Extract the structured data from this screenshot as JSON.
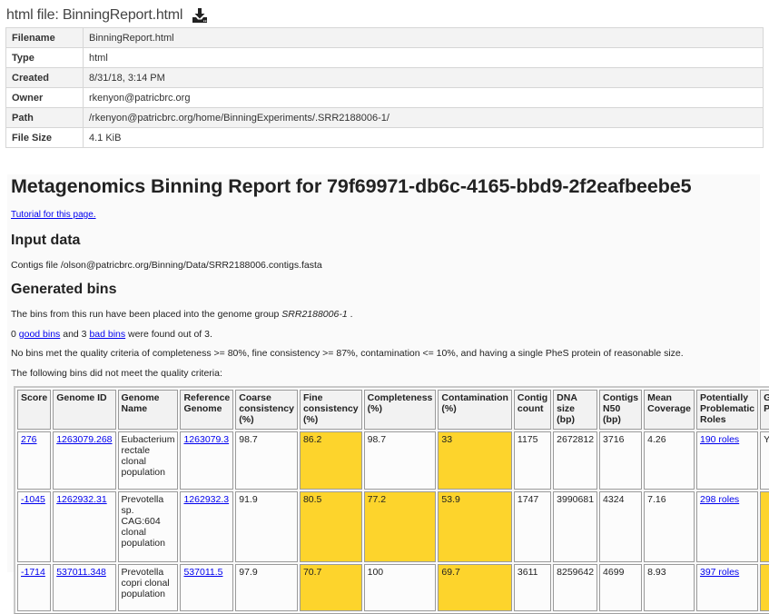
{
  "file_header": {
    "title": "html file: BinningReport.html",
    "download_icon": "download-icon"
  },
  "meta": [
    {
      "key": "Filename",
      "value": "BinningReport.html"
    },
    {
      "key": "Type",
      "value": "html"
    },
    {
      "key": "Created",
      "value": "8/31/18, 3:14 PM"
    },
    {
      "key": "Owner",
      "value": "rkenyon@patricbrc.org"
    },
    {
      "key": "Path",
      "value": "/rkenyon@patricbrc.org/home/BinningExperiments/.SRR2188006-1/"
    },
    {
      "key": "File Size",
      "value": "4.1 KiB"
    }
  ],
  "report": {
    "title": "Metagenomics Binning Report for 79f69971-db6c-4165-bbd9-2f2eafbeebe5",
    "tutorial_link": "Tutorial for this page.",
    "input_heading": "Input data",
    "contigs_file": "Contigs file /olson@patricbrc.org/Binning/Data/SRR2188006.contigs.fasta",
    "bins_heading": "Generated bins",
    "placed_prefix": "The bins from this run have been placed into the genome group ",
    "genome_group": "SRR2188006-1",
    "placed_suffix": " .",
    "good_count": "0",
    "good_link": "good bins",
    "and_text": " and 3 ",
    "bad_link": "bad bins",
    "found_text": " were found out of 3.",
    "criteria_text": "No bins met the quality criteria of completeness >= 80%, fine consistency >= 87%, contamination <= 10%, and having a single PheS protein of reasonable size.",
    "failed_text": "The following bins did not meet the quality criteria:",
    "warn_color": "#fdd42c"
  },
  "bins_table": {
    "headers": [
      "Score",
      "Genome ID",
      "Genome Name",
      "Reference Genome",
      "Coarse consistency (%)",
      "Fine consistency (%)",
      "Completeness (%)",
      "Contamination (%)",
      "Contig count",
      "DNA size (bp)",
      "Contigs N50 (bp)",
      "Mean Coverage",
      "Potentially Problematic Roles",
      "Good PheS"
    ],
    "rows": [
      {
        "score": "276",
        "genome_id": "1263079.268",
        "genome_name": "Eubacterium rectale clonal population",
        "reference": "1263079.3",
        "coarse": "98.7",
        "fine": "86.2",
        "completeness": "98.7",
        "contamination": "33",
        "contig_count": "1175",
        "dna_size": "2672812",
        "n50": "3716",
        "coverage": "4.26",
        "roles": "190 roles",
        "phes": "Y",
        "warn": {
          "fine": true,
          "completeness": false,
          "contamination": true,
          "phes": false
        }
      },
      {
        "score": "-1045",
        "genome_id": "1262932.31",
        "genome_name": "Prevotella sp. CAG:604 clonal population",
        "reference": "1262932.3",
        "coarse": "91.9",
        "fine": "80.5",
        "completeness": "77.2",
        "contamination": "53.9",
        "contig_count": "1747",
        "dna_size": "3990681",
        "n50": "4324",
        "coverage": "7.16",
        "roles": "298 roles",
        "phes": "",
        "warn": {
          "fine": true,
          "completeness": true,
          "contamination": true,
          "phes": true
        }
      },
      {
        "score": "-1714",
        "genome_id": "537011.348",
        "genome_name": "Prevotella copri clonal population",
        "reference": "537011.5",
        "coarse": "97.9",
        "fine": "70.7",
        "completeness": "100",
        "contamination": "69.7",
        "contig_count": "3611",
        "dna_size": "8259642",
        "n50": "4699",
        "coverage": "8.93",
        "roles": "397 roles",
        "phes": "",
        "warn": {
          "fine": true,
          "completeness": false,
          "contamination": true,
          "phes": true
        }
      }
    ]
  }
}
